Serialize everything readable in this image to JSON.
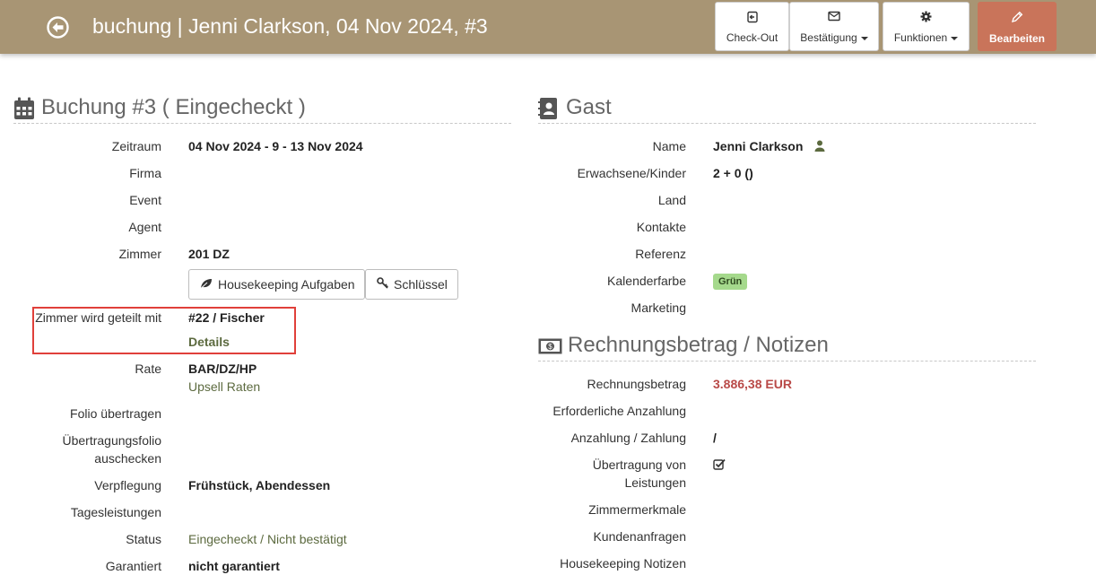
{
  "header": {
    "title": "buchung | Jenni Clarkson, 04 Nov 2024, #3",
    "buttons": {
      "checkout": "Check-Out",
      "bestaetigung": "Bestätigung",
      "funktionen": "Funktionen",
      "bearbeiten": "Bearbeiten"
    },
    "colors": {
      "bar": "#a89574",
      "primary_button": "#c9745a"
    }
  },
  "booking": {
    "title": "Buchung #3 ( Eingecheckt )",
    "labels": {
      "zeitraum": "Zeitraum",
      "firma": "Firma",
      "event": "Event",
      "agent": "Agent",
      "zimmer": "Zimmer",
      "geteilt": "Zimmer wird geteilt mit",
      "rate": "Rate",
      "folio": "Folio übertragen",
      "uebertragungsfolio_1": "Übertragungsfolio",
      "uebertragungsfolio_2": "auschecken",
      "verpflegung": "Verpflegung",
      "tagesleistungen": "Tagesleistungen",
      "status": "Status",
      "garantiert": "Garantiert"
    },
    "values": {
      "zeitraum": "04 Nov 2024 - 9 - 13 Nov 2024",
      "zimmer": "201 DZ",
      "geteilt": "#22 / Fischer",
      "geteilt_link": "Details",
      "rate": "BAR/DZ/HP",
      "rate_link": "Upsell Raten",
      "verpflegung": "Frühstück, Abendessen",
      "status": "Eingecheckt / Nicht bestätigt",
      "garantiert": "nicht garantiert"
    },
    "buttons": {
      "housekeeping": "Housekeeping Aufgaben",
      "schluessel": "Schlüssel"
    }
  },
  "guest": {
    "title": "Gast",
    "labels": {
      "name": "Name",
      "erwachsene": "Erwachsene/Kinder",
      "land": "Land",
      "kontakte": "Kontakte",
      "referenz": "Referenz",
      "kalenderfarbe": "Kalenderfarbe",
      "marketing": "Marketing"
    },
    "values": {
      "name": "Jenni Clarkson",
      "erwachsene": "2 + 0 ()",
      "kalenderfarbe": "Grün"
    }
  },
  "invoice": {
    "title": "Rechnungsbetrag / Notizen",
    "labels": {
      "rechnungsbetrag": "Rechnungsbetrag",
      "anzahlung_erf": "Erforderliche Anzahlung",
      "anzahlung": "Anzahlung / Zahlung",
      "uebertragung_1": "Übertragung von",
      "uebertragung_2": "Leistungen",
      "zimmermerkmale": "Zimmermerkmale",
      "kundenanfragen": "Kundenanfragen",
      "housekeeping_notizen": "Housekeeping Notizen"
    },
    "values": {
      "rechnungsbetrag": "3.886,38 EUR",
      "anzahlung": "/"
    }
  }
}
